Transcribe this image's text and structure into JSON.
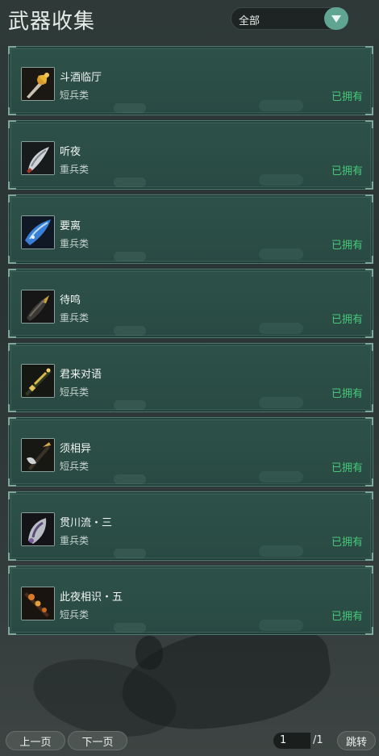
{
  "header": {
    "title": "武器收集",
    "filter": {
      "selected": "全部",
      "arrow_icon": "triangle-down-icon"
    }
  },
  "colors": {
    "owned": "#47c77a",
    "card_bg": "#2b4e47",
    "accent": "#5fa592"
  },
  "weapons": [
    {
      "name": "斗酒临厅",
      "type": "短兵类",
      "status": "已拥有",
      "icon": "golden-dagger-icon"
    },
    {
      "name": "听夜",
      "type": "重兵类",
      "status": "已拥有",
      "icon": "silver-blade-icon"
    },
    {
      "name": "要离",
      "type": "重兵类",
      "status": "已拥有",
      "icon": "blue-blade-icon"
    },
    {
      "name": "待鸣",
      "type": "重兵类",
      "status": "已拥有",
      "icon": "dark-blade-icon"
    },
    {
      "name": "君来对语",
      "type": "短兵类",
      "status": "已拥有",
      "icon": "gold-sword-icon"
    },
    {
      "name": "须相异",
      "type": "短兵类",
      "status": "已拥有",
      "icon": "axe-sword-icon"
    },
    {
      "name": "贯川流・三",
      "type": "重兵类",
      "status": "已拥有",
      "icon": "purple-blade-icon"
    },
    {
      "name": "此夜相识・五",
      "type": "短兵类",
      "status": "已拥有",
      "icon": "ornate-dagger-icon"
    }
  ],
  "pager": {
    "prev_label": "上一页",
    "next_label": "下一页",
    "page_value": "1",
    "page_total": "/1",
    "jump_label": "跳转"
  }
}
